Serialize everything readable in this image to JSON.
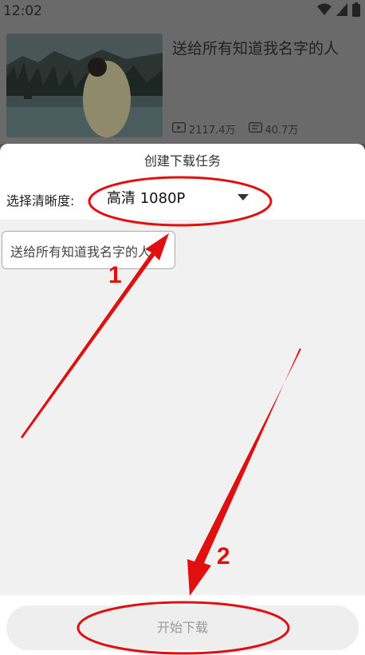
{
  "status": {
    "time": "12:02"
  },
  "video": {
    "title": "送给所有知道我名字的人",
    "plays": "2117.4万",
    "comments": "40.7万"
  },
  "sheet": {
    "title": "创建下载任务",
    "resolution_label": "选择清晰度:",
    "resolution_value": "高清 1080P",
    "file_name": "送给所有知道我名字的人",
    "start_button": "开始下载"
  },
  "annotations": {
    "step1": "1",
    "step2": "2",
    "color": "#e01010"
  }
}
